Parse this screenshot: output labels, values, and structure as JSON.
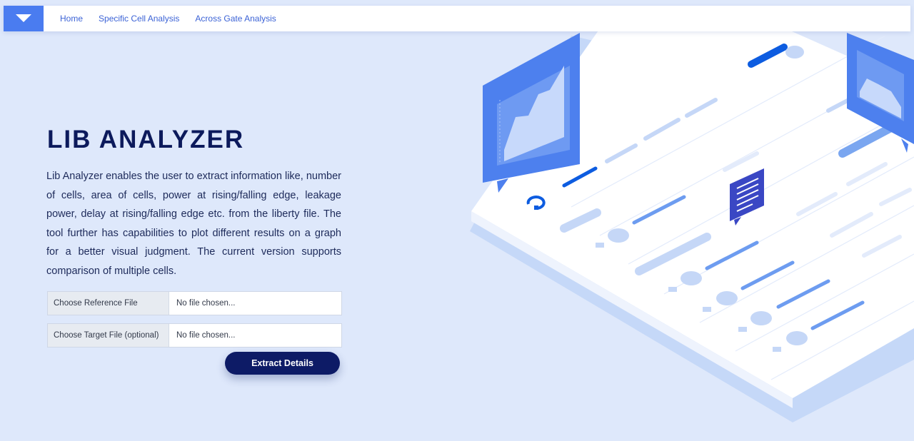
{
  "nav": {
    "toggle_icon": "chevron-down-icon",
    "links": [
      "Home",
      "Specific Cell Analysis",
      "Across Gate Analysis"
    ]
  },
  "hero": {
    "title": "LIB ANALYZER",
    "description": "Lib Analyzer enables the user to extract information like, number of cells, area of cells, power at rising/falling edge, leakage power, delay at rising/falling edge etc. from the liberty file. The tool further has capabilities to plot different results on a graph for a better visual judgment. The current version supports comparison of multiple cells."
  },
  "form": {
    "reference": {
      "label": "Choose Reference File",
      "value": "No file chosen..."
    },
    "target": {
      "label": "Choose Target File (optional)",
      "value": "No file chosen..."
    },
    "submit_label": "Extract Details"
  },
  "colors": {
    "background": "#dee8fb",
    "accent": "#4a7cf0",
    "nav_link": "#3c63d6",
    "title": "#0c1a5c",
    "button": "#0d1b66"
  }
}
